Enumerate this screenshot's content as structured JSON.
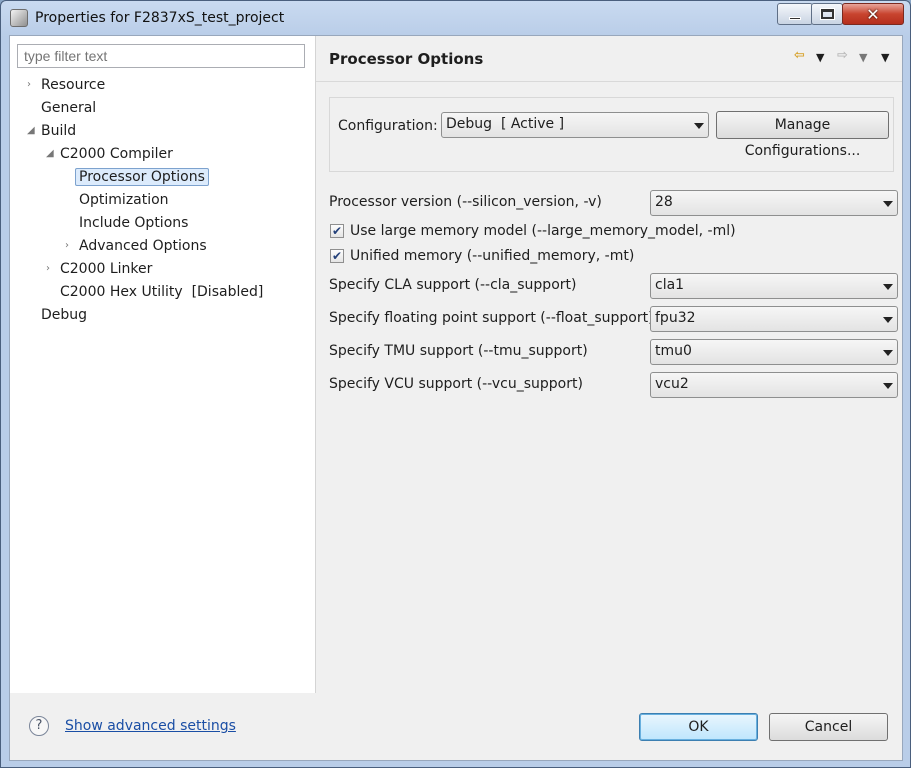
{
  "window": {
    "title": "Properties for F2837xS_test_project"
  },
  "filter": {
    "placeholder": "type filter text"
  },
  "tree": {
    "items": [
      {
        "label": "Resource",
        "expander": "›"
      },
      {
        "label": "General",
        "expander": ""
      },
      {
        "label": "Build",
        "expander": "◢"
      },
      {
        "label": "C2000 Compiler",
        "expander": "◢"
      },
      {
        "label": "Processor Options",
        "expander": "",
        "selected": true
      },
      {
        "label": "Optimization",
        "expander": ""
      },
      {
        "label": "Include Options",
        "expander": ""
      },
      {
        "label": "Advanced Options",
        "expander": "›"
      },
      {
        "label": "C2000 Linker",
        "expander": "›"
      },
      {
        "label": "C2000 Hex Utility  [Disabled]",
        "expander": ""
      },
      {
        "label": "Debug",
        "expander": ""
      }
    ]
  },
  "page": {
    "title": "Processor Options",
    "nav_back_icon": "back-arrow-icon",
    "nav_forward_icon": "forward-arrow-icon"
  },
  "configuration": {
    "label": "Configuration:",
    "value": "Debug  [ Active ]",
    "manage_button": "Manage Configurations..."
  },
  "options": {
    "processor_version": {
      "label": "Processor version (--silicon_version, -v)",
      "value": "28"
    },
    "large_memory": {
      "label": "Use large memory model (--large_memory_model, -ml)",
      "checked": true
    },
    "unified_memory": {
      "label": "Unified memory (--unified_memory, -mt)",
      "checked": true
    },
    "cla_support": {
      "label": "Specify CLA support (--cla_support)",
      "value": "cla1"
    },
    "float_support": {
      "label": "Specify floating point support (--float_support)",
      "value": "fpu32"
    },
    "tmu_support": {
      "label": "Specify TMU support (--tmu_support)",
      "value": "tmu0"
    },
    "vcu_support": {
      "label": "Specify VCU support (--vcu_support)",
      "value": "vcu2"
    }
  },
  "bottom": {
    "help_icon": "help-icon",
    "advanced_link": "Show advanced settings",
    "ok_label": "OK",
    "cancel_label": "Cancel"
  },
  "colors": {
    "accent": "#3c7fb1",
    "selection": "#dcebfc",
    "link": "#1a4ea5"
  }
}
